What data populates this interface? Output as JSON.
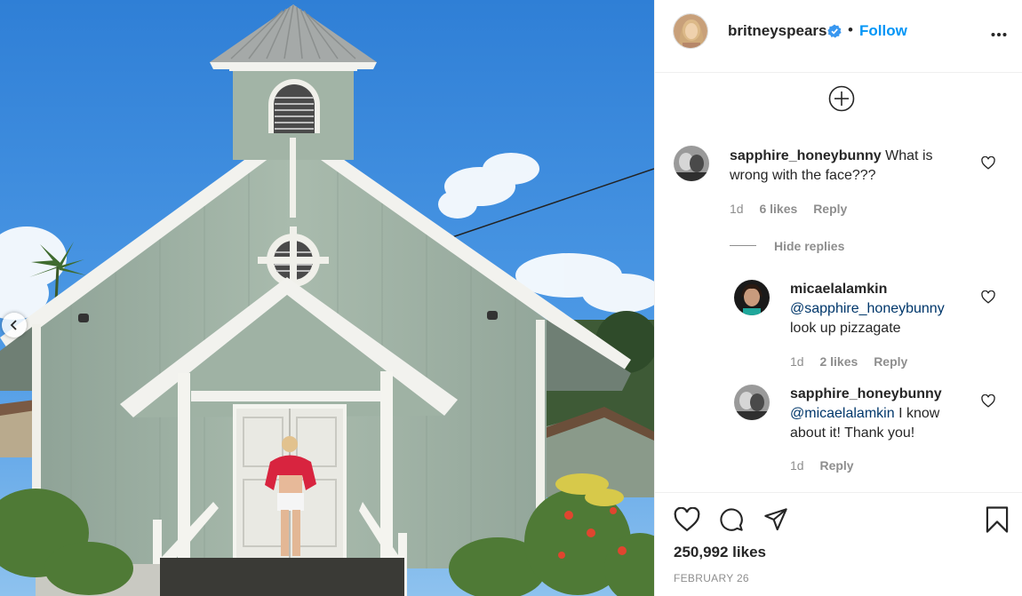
{
  "post": {
    "username": "britneyspears",
    "separator": "•",
    "follow_label": "Follow",
    "likes": "250,992 likes",
    "date": "FEBRUARY 26"
  },
  "comments": [
    {
      "username": "sapphire_honeybunny",
      "text": "What is wrong with the face???",
      "age": "1d",
      "likes": "6 likes",
      "reply_label": "Reply"
    }
  ],
  "hide_replies_label": "Hide replies",
  "replies": [
    {
      "username": "micaelalamkin",
      "mention": "@sapphire_honeybunny",
      "text": "look up pizzagate",
      "age": "1d",
      "likes": "2 likes",
      "reply_label": "Reply"
    },
    {
      "username": "sapphire_honeybunny",
      "mention": "@micaelalamkin",
      "text": "I know about it! Thank you!",
      "age": "1d",
      "reply_label": "Reply"
    }
  ],
  "icons": {
    "verified": "verified-badge-icon",
    "more": "more-options-icon",
    "load_more": "load-more-comments-icon",
    "like": "heart-icon",
    "comment": "comment-icon",
    "share": "paper-plane-icon",
    "save": "bookmark-icon",
    "prev": "chevron-left-icon"
  },
  "colors": {
    "link_blue": "#0095f6",
    "mention_blue": "#00376b",
    "muted": "#8e8e8e",
    "text": "#262626",
    "sky": "#3a8de0",
    "church_wall": "#a7b8a9"
  }
}
